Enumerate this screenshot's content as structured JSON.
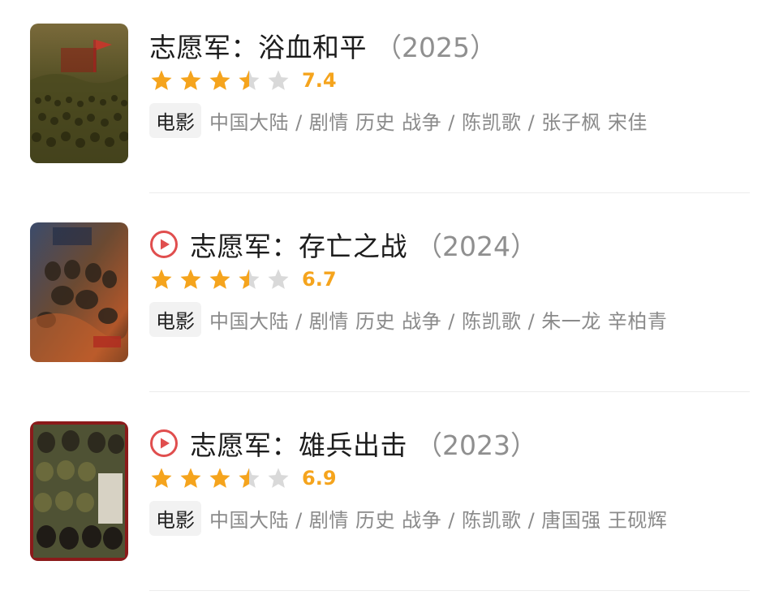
{
  "colors": {
    "star_filled": "#f5a41d",
    "star_empty": "#d9d9d9",
    "play_icon": "#e04e4e",
    "title": "#1c1c1c",
    "year": "#8f8f8f",
    "meta": "#8a8a8a"
  },
  "movies": [
    {
      "title": "志愿军：浴血和平",
      "year": "（2025）",
      "rating": 7.4,
      "rating_text": "7.4",
      "stars_out_of_5": 3.5,
      "type": "电影",
      "meta": "中国大陆 / 剧情 历史 战争 / 陈凯歌 / 张子枫 宋佳",
      "has_play_icon": false,
      "poster_icon": "poster-image"
    },
    {
      "title": "志愿军：存亡之战",
      "year": "（2024）",
      "rating": 6.7,
      "rating_text": "6.7",
      "stars_out_of_5": 3.5,
      "type": "电影",
      "meta": "中国大陆 / 剧情 历史 战争 / 陈凯歌 / 朱一龙 辛柏青",
      "has_play_icon": true,
      "play_icon": "play-circle-icon",
      "poster_icon": "poster-image"
    },
    {
      "title": "志愿军：雄兵出击",
      "year": "（2023）",
      "rating": 6.9,
      "rating_text": "6.9",
      "stars_out_of_5": 3.5,
      "type": "电影",
      "meta": "中国大陆 / 剧情 历史 战争 / 陈凯歌 / 唐国强 王砚辉",
      "has_play_icon": true,
      "play_icon": "play-circle-icon",
      "poster_icon": "poster-image"
    }
  ]
}
